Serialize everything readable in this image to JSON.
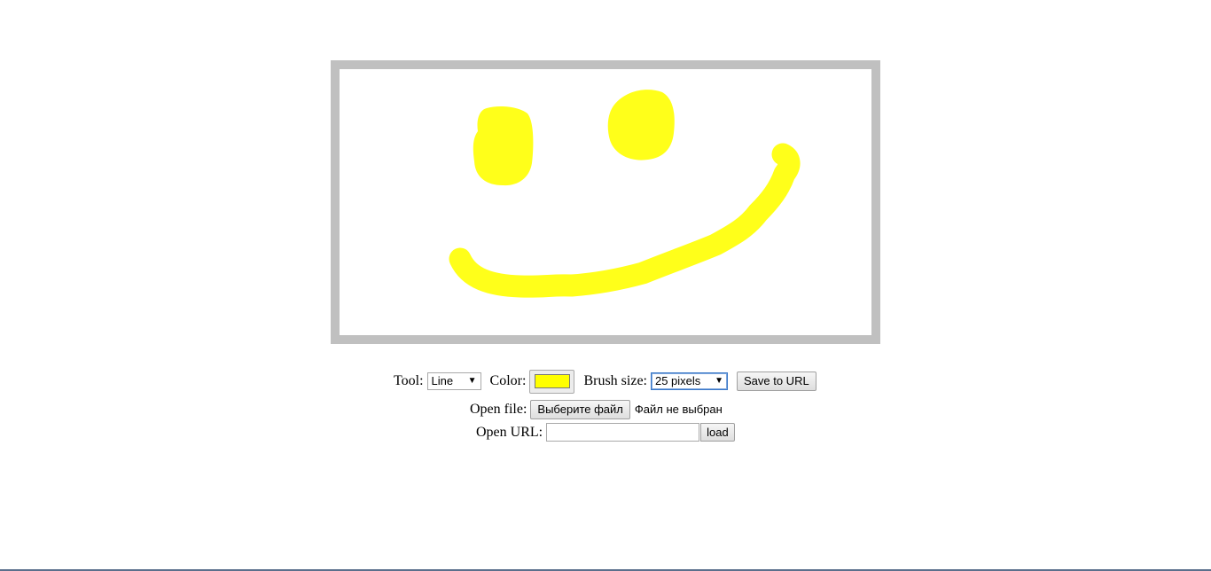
{
  "canvas": {
    "stroke_color": "#ffff1a",
    "brush_size_px": 25
  },
  "toolbar": {
    "tool_label": "Tool:",
    "tool_value": "Line",
    "color_label": "Color:",
    "color_value": "#ffff00",
    "brush_label": "Brush size:",
    "brush_value": "25 pixels",
    "save_label": "Save to URL"
  },
  "open_file": {
    "label": "Open file:",
    "button_label": "Выберите файл",
    "status": "Файл не выбран"
  },
  "open_url": {
    "label": "Open URL:",
    "value": "",
    "load_label": "load"
  },
  "icons": {
    "dropdown": "chevron-down-icon"
  },
  "colors": {
    "frame": "#c0c0c0",
    "taskbar": "#5a6f8c"
  }
}
